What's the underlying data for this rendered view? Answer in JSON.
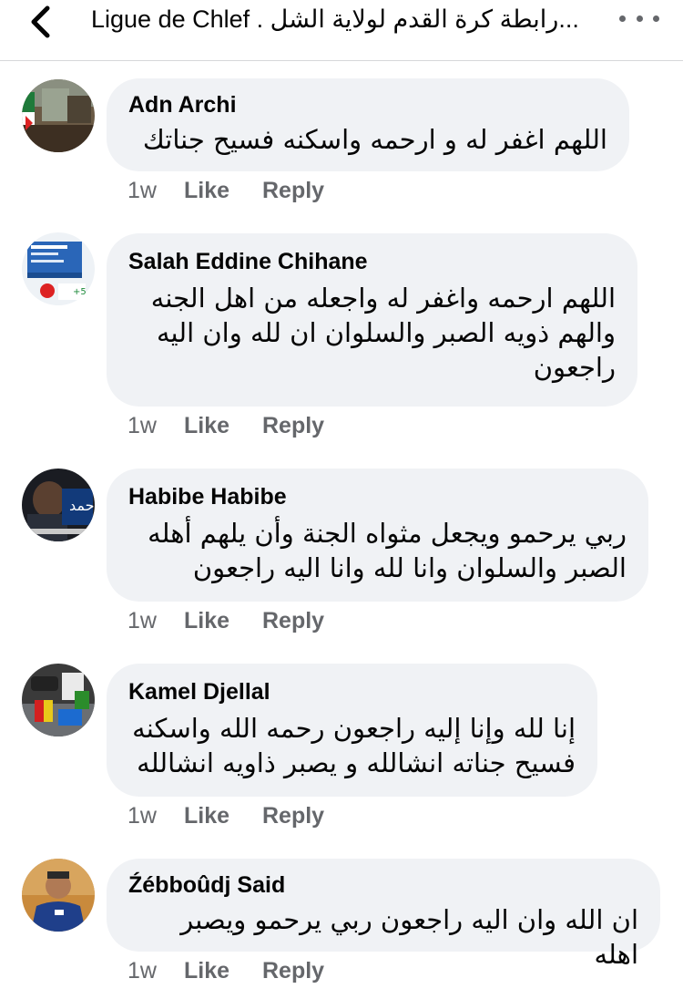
{
  "header": {
    "title": "Ligue de Chlef . رابطة كرة القدم لولاية الشل...",
    "back_icon": "chevron-left-icon",
    "more_icon": "more-horizontal-icon"
  },
  "actions": {
    "like": "Like",
    "reply": "Reply"
  },
  "comments": [
    {
      "author": "Adn Archi",
      "text": "اللهم اغفر له و ارحمه واسكنه فسيح جناتك",
      "time": "1w"
    },
    {
      "author": "Salah Eddine Chihane",
      "text": "اللهم ارحمه واغفر  له واجعله من اهل الجنه والهم ذويه الصبر والسلوان ان لله وان اليه راجعون",
      "time": "1w"
    },
    {
      "author": "Habibe Habibe",
      "text": "ربي يرحمو ويجعل مثواه الجنة وأن يلهم أهله الصبر والسلوان وانا لله وانا اليه راجعون",
      "time": "1w"
    },
    {
      "author": "Kamel Djellal",
      "text": "إنا لله وإنا إليه راجعون رحمه الله واسكنه فسيح جناته انشالله و يصبر ذاويه انشالله",
      "time": "1w"
    },
    {
      "author": "Źébboûdj Said",
      "text": "ان الله وان اليه راجعون ربي يرحمو ويصبر اهله",
      "time": "1w"
    }
  ]
}
